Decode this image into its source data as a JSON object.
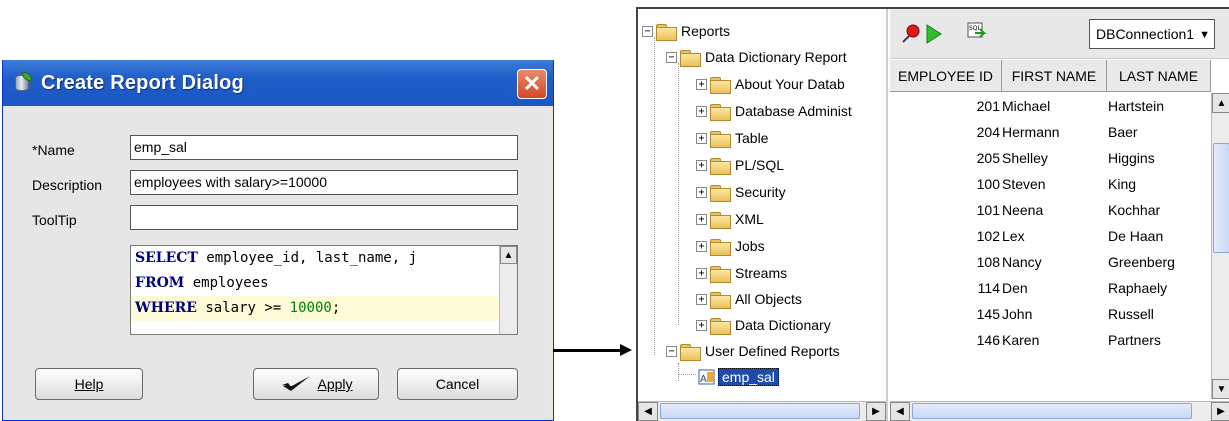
{
  "dialog": {
    "title": "Create Report Dialog",
    "close_icon": "close-icon",
    "name_label": "*Name",
    "name_value": "emp_sal",
    "description_label": "Description",
    "description_value": "employees with salary>=10000",
    "tooltip_label": "ToolTip",
    "tooltip_value": "",
    "sql": {
      "line1_kw": "SELECT",
      "line1_rest": " employee_id, last_name, j",
      "line2_kw": "FROM",
      "line2_rest": " employees",
      "line3_kw": "WHERE",
      "line3_mid": " salary >= ",
      "line3_num": "10000",
      "line3_end": ";"
    },
    "buttons": {
      "help": "Help",
      "apply": "Apply",
      "cancel": "Cancel"
    }
  },
  "tree": {
    "root": "Reports",
    "data_dictionary": "Data Dictionary Report",
    "children": [
      "About Your Datab",
      "Database Administ",
      "Table",
      "PL/SQL",
      "Security",
      "XML",
      "Jobs",
      "Streams",
      "All Objects",
      "Data Dictionary"
    ],
    "user_defined": "User Defined Reports",
    "report": "emp_sal"
  },
  "toolbar": {
    "connection": "DBConnection1",
    "icons": [
      "pin-icon",
      "run-icon",
      "sql-icon"
    ]
  },
  "grid": {
    "columns": [
      "EMPLOYEE ID",
      "FIRST NAME",
      "LAST NAME"
    ],
    "rows": [
      [
        "201",
        "Michael",
        "Hartstein"
      ],
      [
        "204",
        "Hermann",
        "Baer"
      ],
      [
        "205",
        "Shelley",
        "Higgins"
      ],
      [
        "100",
        "Steven",
        "King"
      ],
      [
        "101",
        "Neena",
        "Kochhar"
      ],
      [
        "102",
        "Lex",
        "De Haan"
      ],
      [
        "108",
        "Nancy",
        "Greenberg"
      ],
      [
        "114",
        "Den",
        "Raphaely"
      ],
      [
        "145",
        "John",
        "Russell"
      ],
      [
        "146",
        "Karen",
        "Partners"
      ]
    ]
  }
}
